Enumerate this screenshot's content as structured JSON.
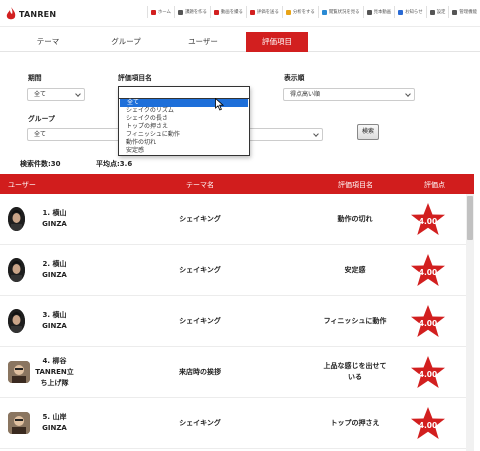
{
  "header": {
    "logo_text": "TANREN",
    "nav": [
      {
        "label": "ホーム",
        "icon": "home-icon",
        "color": "#d21f1f"
      },
      {
        "label": "課題を作る",
        "icon": "document-icon",
        "color": "#555555"
      },
      {
        "label": "動画を撮る",
        "icon": "video-icon",
        "color": "#d21f1f"
      },
      {
        "label": "評価を送る",
        "icon": "evaluate-icon",
        "color": "#d21f1f"
      },
      {
        "label": "分析をする",
        "icon": "analyze-icon",
        "color": "#e8a317"
      },
      {
        "label": "閲覧状況を見る",
        "icon": "users-icon",
        "color": "#2a8ad4"
      },
      {
        "label": "見本動画",
        "icon": "sample-video-icon",
        "color": "#555555"
      },
      {
        "label": "お知らせ",
        "icon": "bell-icon",
        "color": "#2a6ad4"
      },
      {
        "label": "設定",
        "icon": "gear-icon",
        "color": "#555555"
      },
      {
        "label": "管理機能",
        "icon": "admin-icon",
        "color": "#555555"
      }
    ]
  },
  "tabs": [
    {
      "label": "テーマ",
      "active": false
    },
    {
      "label": "グループ",
      "active": false
    },
    {
      "label": "ユーザー",
      "active": false
    },
    {
      "label": "評価項目",
      "active": true
    }
  ],
  "filters": {
    "period_label": "期間",
    "period_value": "全て",
    "item_label": "評価項目名",
    "order_label": "表示順",
    "order_value": "得点高い順",
    "group_label": "グループ",
    "group_value": "全て",
    "search_button": "検索"
  },
  "dropdown": {
    "options": [
      "全て",
      "シェイクのリズム",
      "シェイクの長さ",
      "トップの押さえ",
      "フィニッシュに動作",
      "動作の切れ",
      "安定感"
    ],
    "selected_index": 0
  },
  "stats": {
    "count_text": "検索件数:30",
    "avg_text": "平均点:3.6"
  },
  "table": {
    "columns": [
      "ユーザー",
      "テーマ名",
      "評価項目名",
      "評価点"
    ],
    "rows": [
      {
        "user": "1. 横山\nGINZA",
        "theme": "シェイキング",
        "item": "動作の切れ",
        "score": "4.00"
      },
      {
        "user": "2. 横山\nGINZA",
        "theme": "シェイキング",
        "item": "安定感",
        "score": "4.00"
      },
      {
        "user": "3. 横山\nGINZA",
        "theme": "シェイキング",
        "item": "フィニッシュに動作",
        "score": "4.00"
      },
      {
        "user": "4. 柳谷\nTANREN立\nち上げ隊",
        "theme": "来店時の挨拶",
        "item": "上品な感じを出せて\nいる",
        "score": "4.00"
      },
      {
        "user": "5. 山岸\nGINZA",
        "theme": "シェイキング",
        "item": "トップの押さえ",
        "score": "4.00"
      }
    ]
  },
  "colors": {
    "accent": "#d21f1f",
    "dropdown_selected": "#1e6fd9"
  }
}
